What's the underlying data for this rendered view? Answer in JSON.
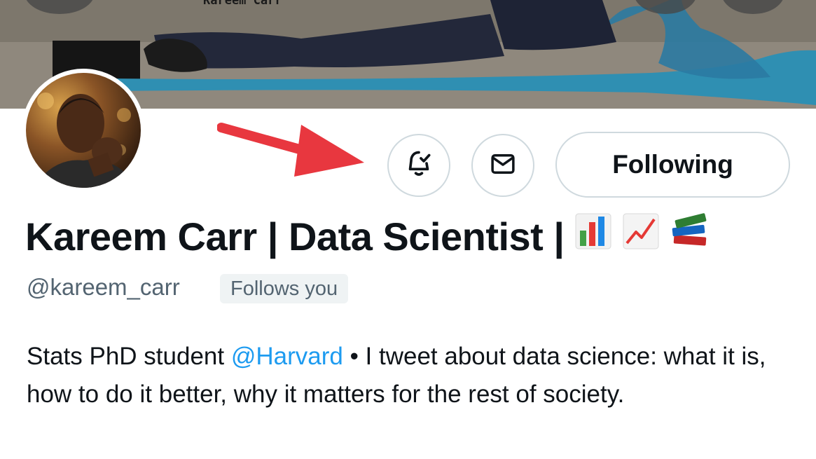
{
  "banner": {
    "text": "Kareem Carr"
  },
  "header": {
    "notifications_icon": "bell-check-icon",
    "message_icon": "envelope-icon",
    "following_label": "Following"
  },
  "profile": {
    "display_name": "Kareem Carr | Data Scientist |",
    "emojis": [
      "bar-chart-emoji",
      "chart-increasing-emoji",
      "books-emoji"
    ],
    "handle": "@kareem_carr",
    "follows_you_label": "Follows you",
    "bio_prefix": "Stats PhD student ",
    "bio_mention": "@Harvard",
    "bio_suffix": " • I tweet about data science: what it is, how to do it better, why it matters for the rest of society."
  },
  "annotation": {
    "arrow_color": "#e8373f"
  },
  "colors": {
    "text": "#0f1419",
    "secondary": "#536471",
    "link": "#1d9bf0",
    "border": "#cfd9de",
    "badge_bg": "#eff3f4"
  }
}
